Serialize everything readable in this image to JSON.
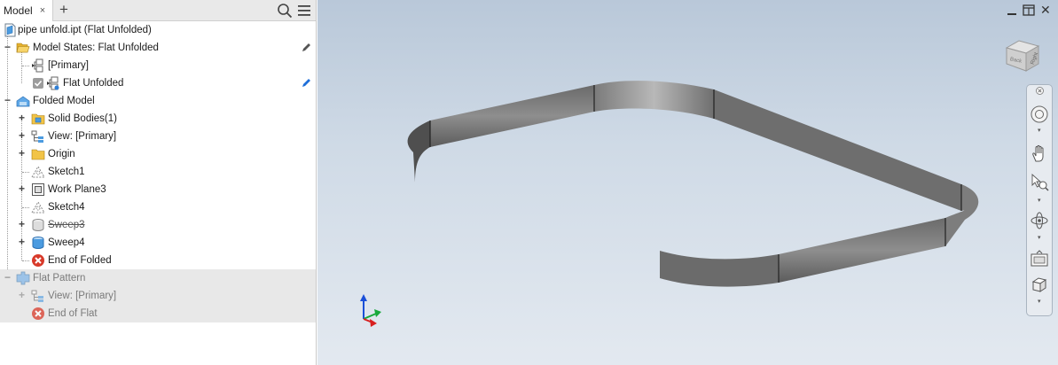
{
  "browser": {
    "tab_label": "Model",
    "tab_close": "×",
    "tab_add": "+",
    "tree": [
      {
        "label": "pipe unfold.ipt (Flat Unfolded)",
        "icon": "part-file-icon"
      },
      {
        "label": "Model States: Flat Unfolded",
        "icon": "open-folder-icon"
      },
      {
        "label": "[Primary]",
        "icon": "model-state-icon"
      },
      {
        "label": "Flat Unfolded",
        "icon": "model-state-icon"
      },
      {
        "label": "Folded Model",
        "icon": "folded-model-icon"
      },
      {
        "label": "Solid Bodies(1)",
        "icon": "solid-bodies-folder-icon"
      },
      {
        "label": "View: [Primary]",
        "icon": "view-rep-icon"
      },
      {
        "label": "Origin",
        "icon": "folder-icon"
      },
      {
        "label": "Sketch1",
        "icon": "sketch-icon"
      },
      {
        "label": "Work Plane3",
        "icon": "work-plane-icon"
      },
      {
        "label": "Sketch4",
        "icon": "sketch-icon"
      },
      {
        "label": "Sweep3",
        "icon": "sweep-icon"
      },
      {
        "label": "Sweep4",
        "icon": "sweep-icon"
      },
      {
        "label": "End of Folded",
        "icon": "end-of-part-icon"
      },
      {
        "label": "Flat Pattern",
        "icon": "flat-pattern-icon"
      },
      {
        "label": "View: [Primary]",
        "icon": "view-rep-icon"
      },
      {
        "label": "End of Flat",
        "icon": "end-of-part-icon"
      }
    ]
  },
  "viewport": {
    "viewcube_face": "Right",
    "viewcube_side": "Back"
  },
  "colors": {
    "accent": "#1e6fd9",
    "end_marker": "#d83a2a",
    "folder": "#f2c447"
  }
}
